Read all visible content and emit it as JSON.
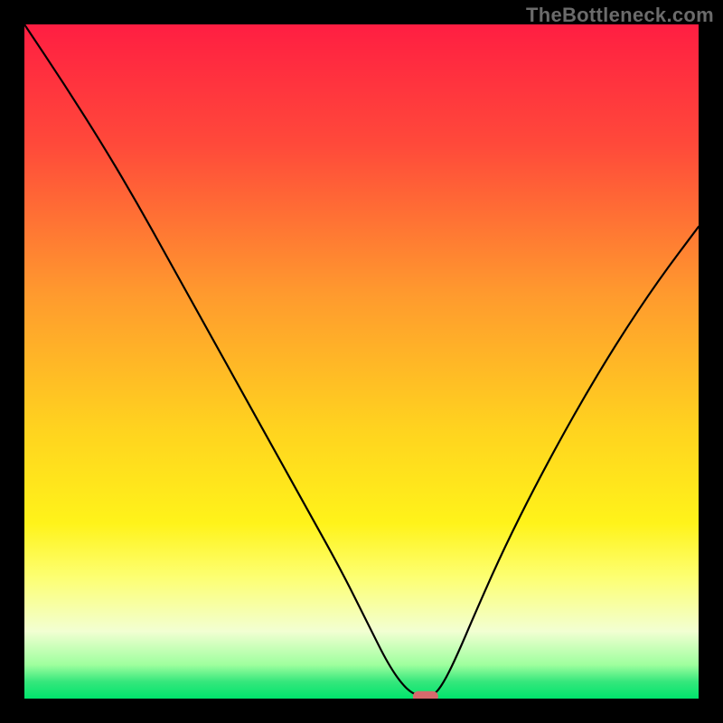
{
  "watermark": "TheBottleneck.com",
  "chart_data": {
    "type": "line",
    "title": "",
    "xlabel": "",
    "ylabel": "",
    "xlim": [
      0,
      100
    ],
    "ylim": [
      0,
      100
    ],
    "grid": false,
    "legend": false,
    "background_gradient": {
      "stops": [
        {
          "offset": 0.0,
          "color": "#ff1e42"
        },
        {
          "offset": 0.18,
          "color": "#ff4a3a"
        },
        {
          "offset": 0.4,
          "color": "#ff9a2e"
        },
        {
          "offset": 0.6,
          "color": "#ffd31f"
        },
        {
          "offset": 0.74,
          "color": "#fff31a"
        },
        {
          "offset": 0.82,
          "color": "#fdff72"
        },
        {
          "offset": 0.9,
          "color": "#f2ffd2"
        },
        {
          "offset": 0.95,
          "color": "#9eff9e"
        },
        {
          "offset": 0.975,
          "color": "#35e77c"
        },
        {
          "offset": 1.0,
          "color": "#00e56c"
        }
      ]
    },
    "series": [
      {
        "name": "bottleneck-curve",
        "x": [
          0,
          6,
          12,
          17,
          22,
          27,
          32,
          37,
          42,
          47,
          51,
          54,
          56.5,
          58.5,
          60.5,
          62,
          64,
          67,
          71,
          76,
          82,
          88,
          94,
          100
        ],
        "values": [
          100,
          91,
          81.5,
          73,
          64,
          55,
          46,
          37,
          28,
          19,
          11,
          5,
          1.5,
          0.3,
          0.3,
          2,
          6,
          13,
          22,
          32,
          43,
          53,
          62,
          70
        ]
      }
    ],
    "marker": {
      "x": 59.5,
      "y": 0.3,
      "color": "#d56a6c"
    }
  }
}
